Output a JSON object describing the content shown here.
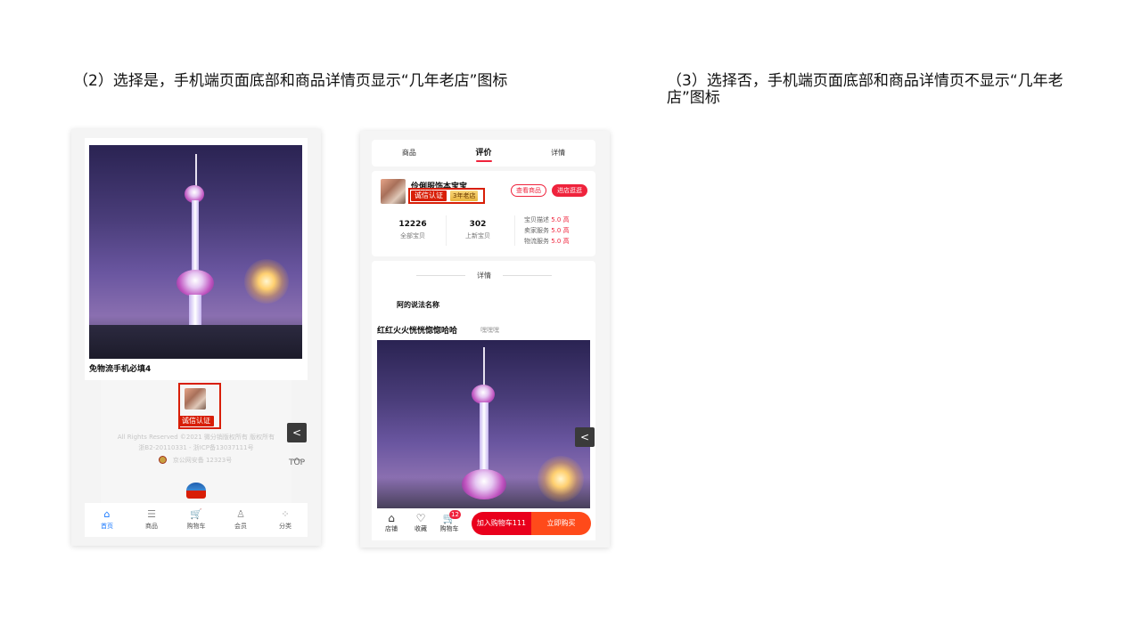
{
  "headings": {
    "left": "（2）选择是，手机端页面底部和商品详情页显示“几年老店”图标",
    "right": "（3）选择否，手机端页面底部和商品详情页不显示“几年老店”图标"
  },
  "phone1": {
    "product_name": "免物流手机必填4",
    "badge": "诚信认证",
    "copyright_1": "All Rights Reserved ©2021 微分销版权所有 版权所有",
    "copyright_2": "浙B2-20110331 - 浙ICP备13037111号",
    "copyright_3": "京公网安备 12323号",
    "back_glyph": "<",
    "top_arrow": "︿",
    "top_label": "TOP",
    "tabs": [
      {
        "label": "首页",
        "icon": "⌂",
        "icon_name": "home-icon"
      },
      {
        "label": "商品",
        "icon": "☰",
        "icon_name": "list-icon"
      },
      {
        "label": "购物车",
        "icon": "🛒",
        "icon_name": "cart-icon"
      },
      {
        "label": "会员",
        "icon": "♙",
        "icon_name": "user-icon"
      },
      {
        "label": "分类",
        "icon": "⁘",
        "icon_name": "grid-icon"
      }
    ]
  },
  "phone2": {
    "tabs": [
      "商品",
      "评价",
      "详情"
    ],
    "shop_name": "伶俐服饰本宝宝",
    "badge": "诚信认证",
    "old_shop": "3年老店",
    "view_goods": "查看商品",
    "enter_shop": "进店逛逛",
    "stats": [
      {
        "value": "12226",
        "label": "全部宝贝"
      },
      {
        "value": "302",
        "label": "上新宝贝"
      }
    ],
    "ratings": [
      {
        "label": "宝贝描述",
        "score": "5.0",
        "level": "高"
      },
      {
        "label": "卖家服务",
        "score": "5.0",
        "level": "高"
      },
      {
        "label": "物流服务",
        "score": "5.0",
        "level": "高"
      }
    ],
    "detail_title": "详情",
    "subtitle": "阿的说法名称",
    "headline": "红红火火恍恍惚惚哈哈",
    "headline_tag": "嘿嘿嘿",
    "back_glyph": "<",
    "bottom": {
      "store": "店铺",
      "store_icon": "⌂",
      "fav": "收藏",
      "fav_icon": "♡",
      "cart": "购物车",
      "cart_icon": "🛒",
      "cart_count": "12",
      "add_cart": "加入购物车111",
      "buy_now": "立即购买"
    }
  },
  "colors": {
    "accent_red": "#ef233c",
    "badge_red": "#d81e06",
    "active_tab_blue": "#1677ff"
  }
}
